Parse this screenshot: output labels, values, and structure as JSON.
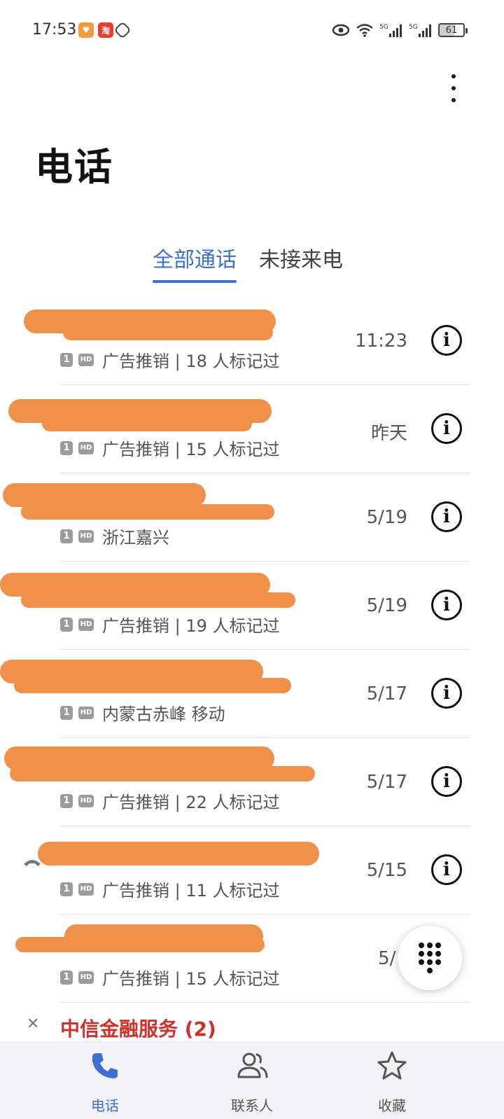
{
  "status_bar": {
    "time": "17:53",
    "battery": "61",
    "icons": [
      "eye-icon",
      "wifi-icon",
      "signal-5g-icon",
      "signal-5g-icon",
      "battery-icon"
    ]
  },
  "header": {
    "title": "电话",
    "more_icon": "more-vertical-icon"
  },
  "tabs": [
    {
      "label": "全部通话",
      "active": true
    },
    {
      "label": "未接来电",
      "active": false
    }
  ],
  "calls": [
    {
      "subtitle": "广告推销 | 18 人标记过",
      "time": "11:23"
    },
    {
      "subtitle": "广告推销 | 15 人标记过",
      "time": "昨天"
    },
    {
      "subtitle": "浙江嘉兴",
      "time": "5/19"
    },
    {
      "subtitle": "广告推销 | 19 人标记过",
      "time": "5/19"
    },
    {
      "subtitle": "内蒙古赤峰 移动",
      "time": "5/17"
    },
    {
      "subtitle": "广告推销 | 22 人标记过",
      "time": "5/17"
    },
    {
      "subtitle": "广告推销 | 11 人标记过",
      "time": "5/15"
    },
    {
      "subtitle": "广告推销 | 15 人标记过",
      "time": "5/1"
    }
  ],
  "badges": {
    "sim": "1",
    "hd": "HD"
  },
  "group": {
    "title": "中信金融服务 (2)"
  },
  "bottom_nav": [
    {
      "label": "电话",
      "icon": "phone-icon",
      "active": true
    },
    {
      "label": "联系人",
      "icon": "contacts-icon",
      "active": false
    },
    {
      "label": "收藏",
      "icon": "star-icon",
      "active": false
    }
  ],
  "colors": {
    "accent": "#3b6fd4",
    "redaction": "#f0914a",
    "group_title": "#d0302a"
  }
}
